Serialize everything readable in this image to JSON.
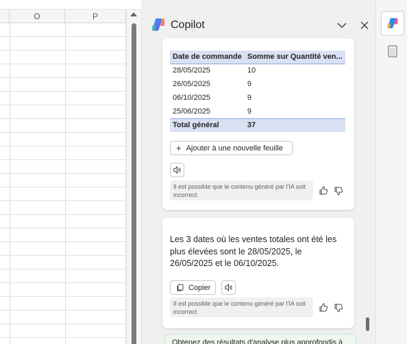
{
  "sheet": {
    "columns": [
      "O",
      "P"
    ]
  },
  "copilot": {
    "title": "Copilot",
    "header_icons": {
      "collapse": "chevron-down-icon",
      "close": "close-icon"
    },
    "table": {
      "headers": [
        "Date de commande",
        "Somme sur Quantité ven..."
      ],
      "rows": [
        [
          "28/05/2025",
          "10"
        ],
        [
          "26/05/2025",
          "9"
        ],
        [
          "06/10/2025",
          "9"
        ],
        [
          "25/06/2025",
          "9"
        ]
      ],
      "total": [
        "Total général",
        "37"
      ]
    },
    "add_sheet_label": "Ajouter à une nouvelle feuille",
    "disclaimer": "Il est possible que le contenu généré par l'IA soit incorrect",
    "answer": "Les 3 dates où les ventes totales ont été les plus élevées sont le 28/05/2025, le 26/05/2025 et le 06/10/2025.",
    "copy_label": "Copier",
    "banner": "Obtenez des résultats d'analyse plus approfondis à"
  },
  "rail": {
    "items": [
      "copilot-icon",
      "sheet-icon"
    ]
  },
  "colors": {
    "table_header": "#d9e1f2",
    "accent_blue": "#2b7cd3",
    "banner_bg": "#eef7ef"
  }
}
